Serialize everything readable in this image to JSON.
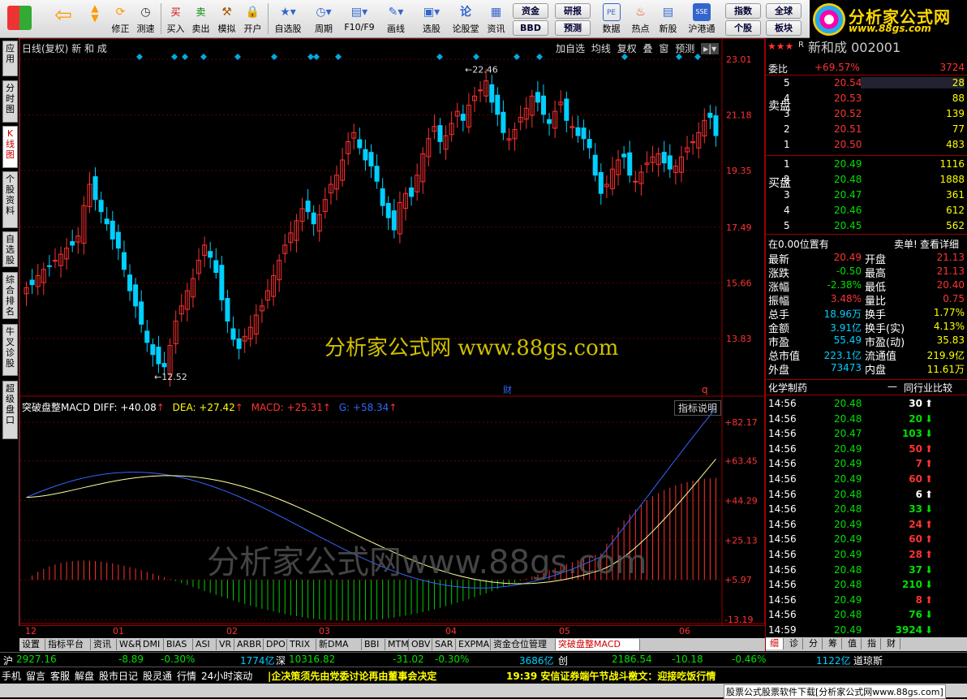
{
  "toolbar": {
    "items": [
      "修正",
      "测速",
      "买入",
      "卖出",
      "模拟",
      "开户",
      "自选股",
      "周期",
      "F10/F9",
      "画线",
      "选股",
      "论股堂",
      "资讯",
      "数据",
      "热点",
      "新股",
      "沪港通"
    ],
    "small": [
      "资金",
      "研报",
      "BBD",
      "预测",
      "指数",
      "全球",
      "个股",
      "板块"
    ]
  },
  "logo": {
    "title": "分析家公式网",
    "url": "www.88gs.com"
  },
  "left_tabs": [
    "应用",
    "分时图",
    "K线图",
    "个股资料",
    "自选股",
    "综合排名",
    "牛叉诊股",
    "超级盘口"
  ],
  "chart": {
    "title": "日线(复权)",
    "stock": "新 和 成",
    "buttons": [
      "加自选",
      "均线",
      "复权",
      "叠",
      "窗",
      "预测"
    ],
    "y_ticks": [
      "23.01",
      "21.18",
      "19.35",
      "17.49",
      "15.66",
      "13.83"
    ],
    "high_label": "22.46",
    "low_label": "12.52",
    "fin_mark": "财",
    "q_mark": "q",
    "macd_title": "突破盘整MACD",
    "diff": "DIFF: +40.08",
    "dea": "DEA: +27.42",
    "macd": "MACD: +25.31",
    "g": "G: +58.34",
    "explain": "指标说明",
    "macd_ticks": [
      "+82.17",
      "+63.45",
      "+44.29",
      "+25.13",
      "+5.97",
      "-13.19"
    ],
    "months": [
      "12",
      "01",
      "02",
      "03",
      "04",
      "05",
      "06"
    ],
    "watermark1": "分析家公式网  www.88gs.com",
    "watermark2": "分析家公式网www.88gs.com"
  },
  "chart_data": {
    "type": "candlestick",
    "title": "日线(复权)",
    "ylim": [
      12.52,
      23.01
    ],
    "high": 22.46,
    "low": 12.52,
    "months": [
      "12",
      "01",
      "02",
      "03",
      "04",
      "05",
      "06"
    ]
  },
  "bottom_tabs": [
    "设置",
    "指标平台",
    "资讯",
    "W&R",
    "DMI",
    "BIAS",
    "ASI",
    "VR",
    "ARBR",
    "DPO",
    "TRIX",
    "新DMA",
    "BBI",
    "MTM",
    "OBV",
    "SAR",
    "EXPMA",
    "资金仓位管理",
    "突破盘整MACD"
  ],
  "quote": {
    "header": "新和成 002001",
    "stars": "★★★",
    "r": "R",
    "weibi_label": "委比",
    "weibi": "+69.57%",
    "weicha": "3724",
    "sell_label": "卖盘",
    "buy_label": "买盘",
    "sells": [
      {
        "n": "5",
        "p": "20.54",
        "v": "28"
      },
      {
        "n": "4",
        "p": "20.53",
        "v": "88"
      },
      {
        "n": "3",
        "p": "20.52",
        "v": "139"
      },
      {
        "n": "2",
        "p": "20.51",
        "v": "77"
      },
      {
        "n": "1",
        "p": "20.50",
        "v": "483"
      }
    ],
    "buys": [
      {
        "n": "1",
        "p": "20.49",
        "v": "1116"
      },
      {
        "n": "2",
        "p": "20.48",
        "v": "1888"
      },
      {
        "n": "3",
        "p": "20.47",
        "v": "361"
      },
      {
        "n": "4",
        "p": "20.46",
        "v": "612"
      },
      {
        "n": "5",
        "p": "20.45",
        "v": "562"
      }
    ],
    "pos": "在0.00位置有",
    "pos2": "卖单!",
    "detail": "查看详细",
    "stats": [
      [
        "最新",
        "20.49",
        "开盘",
        "21.13"
      ],
      [
        "涨跌",
        "-0.50",
        "最高",
        "21.13"
      ],
      [
        "涨幅",
        "-2.38%",
        "最低",
        "20.40"
      ],
      [
        "振幅",
        "3.48%",
        "量比",
        "0.75"
      ],
      [
        "总手",
        "18.96万",
        "换手",
        "1.77%"
      ],
      [
        "金额",
        "3.91亿",
        "换手(实)",
        "4.13%"
      ],
      [
        "市盈",
        "55.49",
        "市盈(动)",
        "35.83"
      ],
      [
        "总市值",
        "223.1亿",
        "流通值",
        "219.9亿"
      ],
      [
        "外盘",
        "73473",
        "内盘",
        "11.61万"
      ]
    ],
    "industry": "化学制药",
    "compare": "同行业比较",
    "ticks": [
      [
        "14:56",
        "20.48",
        "30",
        "w"
      ],
      [
        "14:56",
        "20.48",
        "20",
        "g"
      ],
      [
        "14:56",
        "20.47",
        "103",
        "g"
      ],
      [
        "14:56",
        "20.49",
        "50",
        "r"
      ],
      [
        "14:56",
        "20.49",
        "7",
        "r"
      ],
      [
        "14:56",
        "20.49",
        "60",
        "r"
      ],
      [
        "14:56",
        "20.48",
        "6",
        "w"
      ],
      [
        "14:56",
        "20.48",
        "33",
        "g"
      ],
      [
        "14:56",
        "20.49",
        "24",
        "r"
      ],
      [
        "14:56",
        "20.49",
        "60",
        "r"
      ],
      [
        "14:56",
        "20.49",
        "28",
        "r"
      ],
      [
        "14:56",
        "20.48",
        "37",
        "g"
      ],
      [
        "14:56",
        "20.48",
        "210",
        "g"
      ],
      [
        "14:56",
        "20.49",
        "8",
        "r"
      ],
      [
        "14:56",
        "20.48",
        "76",
        "g"
      ],
      [
        "14:59",
        "20.49",
        "3924",
        "g"
      ]
    ],
    "tabs": [
      "细",
      "诊",
      "分",
      "筹",
      "值",
      "指",
      "财"
    ]
  },
  "status": {
    "sh_label": "沪",
    "sh": "2927.16",
    "sh_ch": "-8.89",
    "sh_pct": "-0.30%",
    "sh_amt": "1774亿",
    "sz_label": "深",
    "sz": "10316.82",
    "sz_ch": "-31.02",
    "sz_pct": "-0.30%",
    "sz_amt": "3686亿",
    "cy_label": "创",
    "cy": "2186.54",
    "cy_ch": "-10.18",
    "cy_pct": "-0.46%",
    "dj_amt": "1122亿",
    "dj": "道琼斯",
    "links": [
      "手机",
      "留言",
      "客服",
      "解盘",
      "股市日记",
      "股灵通",
      "行情",
      "24小时滚动"
    ],
    "news1": "|企决策须先由党委讨论再由董事会决定",
    "news2": "19:39 安信证券端午节战斗檄文：迎接吃饭行情",
    "bottom": "股票公式股票软件下载[分析家公式网www.88gs.com]"
  },
  "colors": {
    "up": "#ff3030",
    "down": "#00d0ff",
    "diff": "#3366ff",
    "dea": "#ffff99"
  }
}
